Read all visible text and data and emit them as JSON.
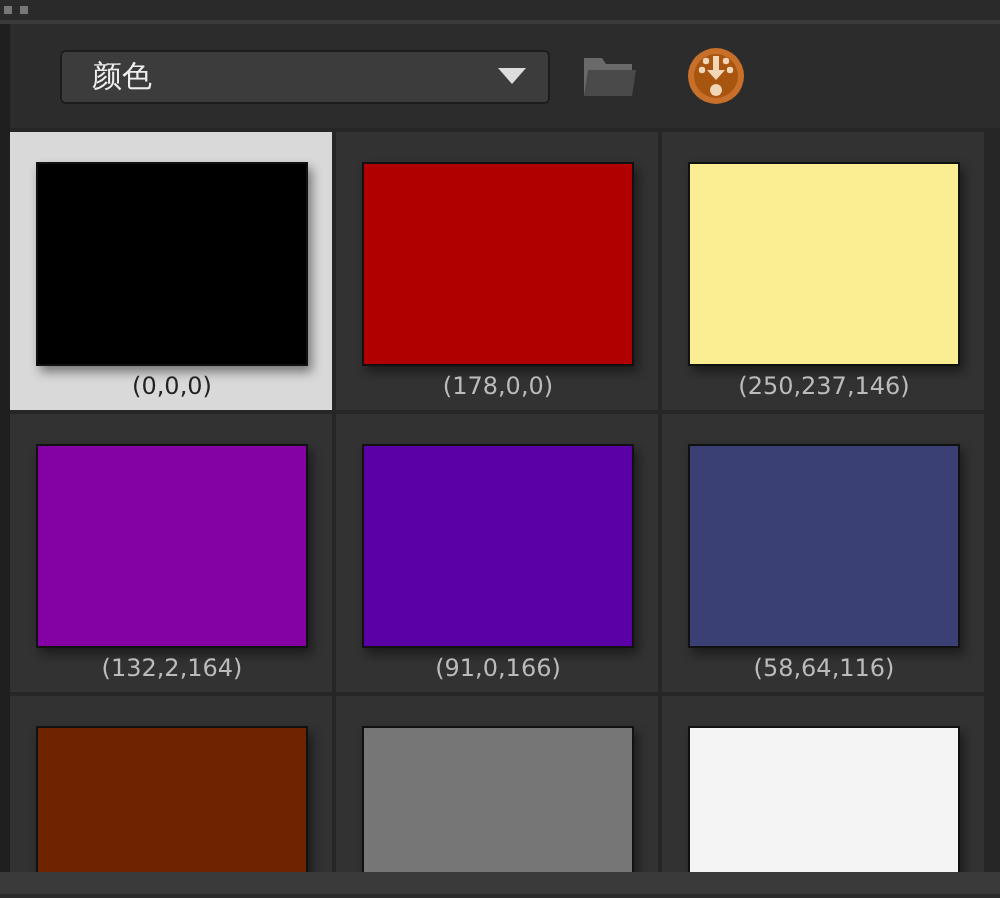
{
  "preset_dropdown": {
    "value": "颜色"
  },
  "swatches": [
    {
      "color": "#000000",
      "label": "(0,0,0)",
      "selected": true
    },
    {
      "color": "#b00000",
      "label": "(178,0,0)",
      "selected": false
    },
    {
      "color": "#faed92",
      "label": "(250,237,146)",
      "selected": false
    },
    {
      "color": "#8402a4",
      "label": "(132,2,164)",
      "selected": false
    },
    {
      "color": "#5b00a6",
      "label": "(91,0,166)",
      "selected": false
    },
    {
      "color": "#3a4074",
      "label": "(58,64,116)",
      "selected": false
    },
    {
      "color": "#6e2400",
      "selected": false
    },
    {
      "color": "#767676",
      "selected": false
    },
    {
      "color": "#f4f4f4",
      "selected": false
    }
  ]
}
